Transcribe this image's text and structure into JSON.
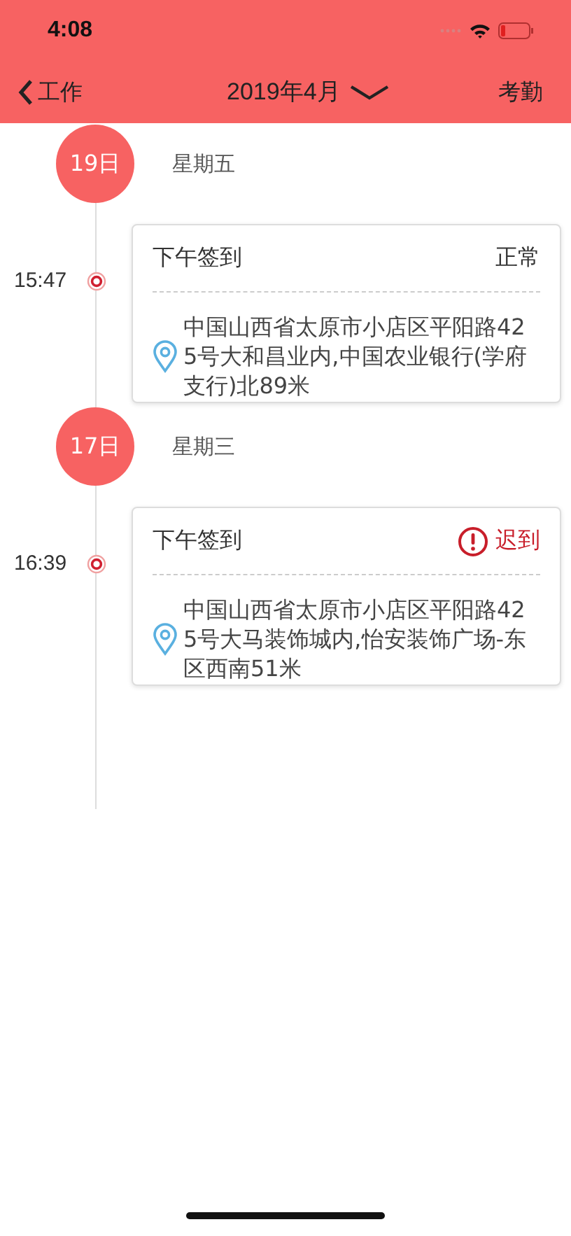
{
  "status_bar": {
    "time": "4:08"
  },
  "nav": {
    "back": "工作",
    "title": "2019年4月",
    "action": "考勤"
  },
  "days": [
    {
      "date": "19日",
      "weekday": "星期五",
      "entries": [
        {
          "time": "15:47",
          "label": "下午签到",
          "status": "正常",
          "kind": "normal",
          "address": "中国山西省太原市小店区平阳路425号大和昌业内,中国农业银行(学府支行)北89米"
        }
      ]
    },
    {
      "date": "17日",
      "weekday": "星期三",
      "entries": [
        {
          "time": "16:39",
          "label": "下午签到",
          "status": "迟到",
          "kind": "late",
          "address": "中国山西省太原市小店区平阳路425号大马装饰城内,怡安装饰广场-东区西南51米"
        }
      ]
    }
  ]
}
